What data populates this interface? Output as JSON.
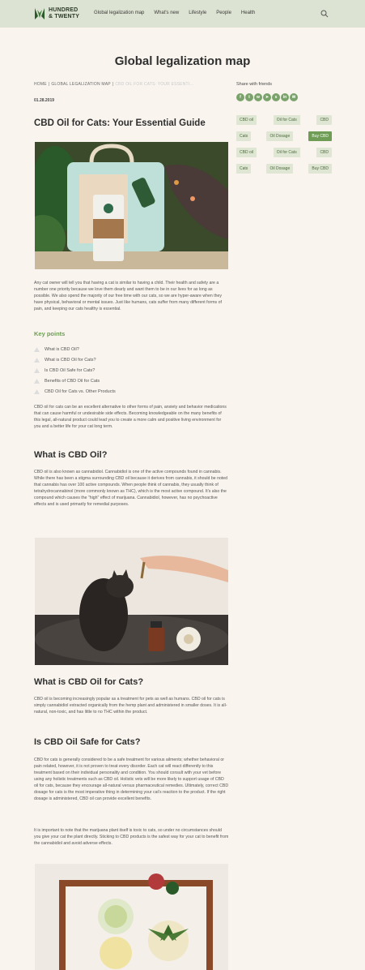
{
  "header": {
    "logo_line1": "HUNDRED",
    "logo_line2": "& TWENTY",
    "nav": [
      "Global legalization map",
      "What's new",
      "Lifestyle",
      "People",
      "Health"
    ]
  },
  "page_title": "Global legalization map",
  "breadcrumb": {
    "home": "HOME",
    "section": "GLOBAL LEGALIZATION MAP",
    "current": "CBD OIL FOR CATS: YOUR ESSENTI..."
  },
  "date": "01.28.2019",
  "share": {
    "label": "Share with friends",
    "icons": [
      "facebook-icon",
      "twitter-icon",
      "whatsapp-icon",
      "telegram-icon",
      "skype-icon",
      "linkedin-icon",
      "email-icon"
    ]
  },
  "tags": [
    [
      "CBD oil",
      "Oil for Cats",
      "CBD"
    ],
    [
      "Cats",
      "Oil Dosage",
      "Buy CBD"
    ],
    [
      "CBD oil",
      "Oil for Cats",
      "CBD"
    ],
    [
      "Cats",
      "Oil Dosage",
      "Buy CBD"
    ]
  ],
  "article": {
    "title": "CBD Oil for Cats: Your Essential Guide",
    "intro": "Any cat owner will tell you that having a cat is similar to having a child. Their health and safety are a number one priority because we love them dearly and want them to be in our lives for as long as possible. We also spend the majority of our free time with our cats, so we are hyper-aware when they have physical, behavioral or mental issues. Just like humans, cats suffer from many different forms of pain, and keeping our cats healthy is essential.",
    "key_points_heading": "Key points",
    "key_points": [
      "What is CBD Oil?",
      "What is CBD Oil for Cats?",
      "Is CBD Oil Safe for Cats?",
      "Benefits of CBD Oil for Cats",
      "CBD Oil for Cats vs. Other Products"
    ],
    "p_after_keypoints": "CBD oil for cats can be an excellent alternative to other forms of pain, anxiety and behavior medications that can cause harmful or undesirable side effects. Becoming knowledgeable on the many benefits of this legal, all-natural product could lead you to create a more calm and positive living environment for you and a better life for your cat long term.",
    "h_what_is_cbd": "What is CBD Oil?",
    "p_what_is_cbd": "CBD oil is also known as cannabidiol. Cannabidiol is one of the active compounds found in cannabis. While there has been a stigma surrounding CBD oil because it derives from cannabis, it should be noted that cannabis has over 100 active compounds. When people think of cannabis, they usually think of tetrahydrocannabinol (more commonly known as THC), which is the most active compound. It's also the compound which causes the \"high\" effect of marijuana. Cannabidiol, however, has no psychoactive effects and is used primarily for remedial purposes.",
    "h_for_cats": "What is CBD Oil for Cats?",
    "p_for_cats": "CBD oil is becoming increasingly popular as a treatment for pets as well as humans. CBD oil for cats is simply cannabidiol extracted organically from the hemp plant and administered in smaller doses. It is all-natural, non-toxic, and has little to no THC within the product.",
    "h_safe": "Is CBD Oil Safe for Cats?",
    "p_safe": "CBD for cats is generally considered to be a safe treatment for various ailments; whether behavioral or pain related, however, it is not proven to treat every disorder. Each cat will react differently to this treatment based on their individual personality and condition. You should consult with your vet before using any holistic treatments such as CBD oil. Holistic vets will be more likely to support usage of CBD oil for cats, because they encourage all-natural versus pharmaceutical remedies. Ultimately, correct CBD dosage for cats is the most imperative thing in determining your cat's reaction to the product. If the right dosage is administered, CBD oil can provide excellent benefits.",
    "p_safe_2": "It is important to note that the marijuana plant itself is toxic to cats, so under no circumstances should you give your cat the plant directly. Sticking to CBD products is the safest way for your cat to benefit from the cannabidiol and avoid adverse effects."
  },
  "colors": {
    "header_bg": "#dde3d2",
    "page_bg": "#f9f4ee",
    "accent_green": "#6f9d56",
    "tag_bg": "#dfe6d3"
  }
}
